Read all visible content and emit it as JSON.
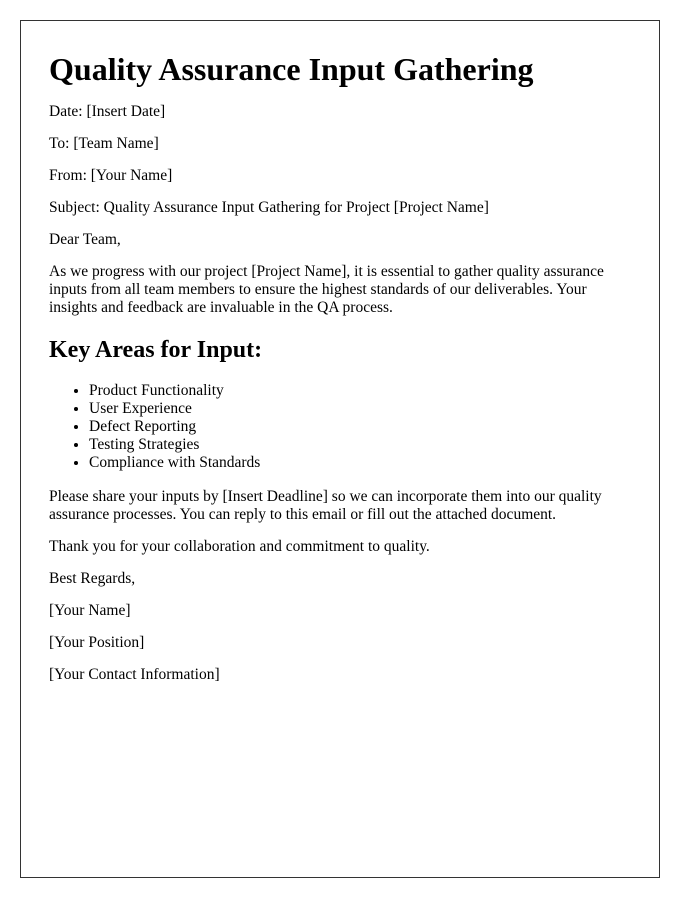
{
  "document": {
    "title": "Quality Assurance Input Gathering",
    "header_fields": [
      "Date: [Insert Date]",
      "To: [Team Name]",
      "From: [Your Name]",
      "Subject: Quality Assurance Input Gathering for Project [Project Name]"
    ],
    "salutation": "Dear Team,",
    "intro_paragraph": "As we progress with our project [Project Name], it is essential to gather quality assurance inputs from all team members to ensure the highest standards of our deliverables. Your insights and feedback are invaluable in the QA process.",
    "section_heading": "Key Areas for Input:",
    "key_areas": [
      "Product Functionality",
      "User Experience",
      "Defect Reporting",
      "Testing Strategies",
      "Compliance with Standards"
    ],
    "request_paragraph": "Please share your inputs by [Insert Deadline] so we can incorporate them into our quality assurance processes. You can reply to this email or fill out the attached document.",
    "thanks": "Thank you for your collaboration and commitment to quality.",
    "closing": "Best Regards,",
    "signature": {
      "name": "[Your Name]",
      "position": "[Your Position]",
      "contact": "[Your Contact Information]"
    }
  }
}
